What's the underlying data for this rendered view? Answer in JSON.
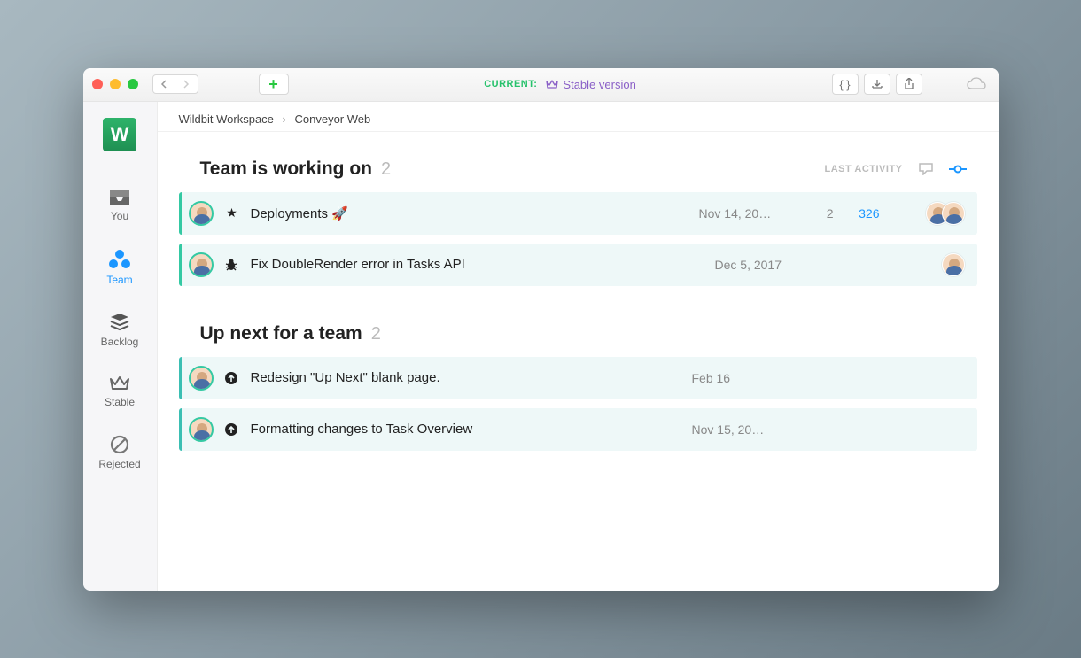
{
  "titlebar": {
    "current_label": "CURRENT:",
    "version": "Stable version"
  },
  "breadcrumb": {
    "workspace": "Wildbit Workspace",
    "project": "Conveyor Web"
  },
  "sidebar": {
    "you": "You",
    "team": "Team",
    "backlog": "Backlog",
    "stable": "Stable",
    "rejected": "Rejected"
  },
  "sections": {
    "working": {
      "title": "Team is working on",
      "count": "2",
      "last_activity": "LAST ACTIVITY"
    },
    "upnext": {
      "title": "Up next for a team",
      "count": "2"
    }
  },
  "tasks_working": [
    {
      "title": "Deployments 🚀",
      "date": "Nov 14, 20…",
      "comments": "2",
      "commits": "326",
      "icon": "star"
    },
    {
      "title": "Fix DoubleRender error in Tasks API",
      "date": "Dec 5, 2017",
      "comments": "",
      "commits": "",
      "icon": "bug"
    }
  ],
  "tasks_upnext": [
    {
      "title": "Redesign \"Up Next\" blank page.",
      "date": "Feb 16",
      "icon": "arrow-up"
    },
    {
      "title": "Formatting changes to Task Overview",
      "date": "Nov 15, 20…",
      "icon": "arrow-up"
    }
  ]
}
